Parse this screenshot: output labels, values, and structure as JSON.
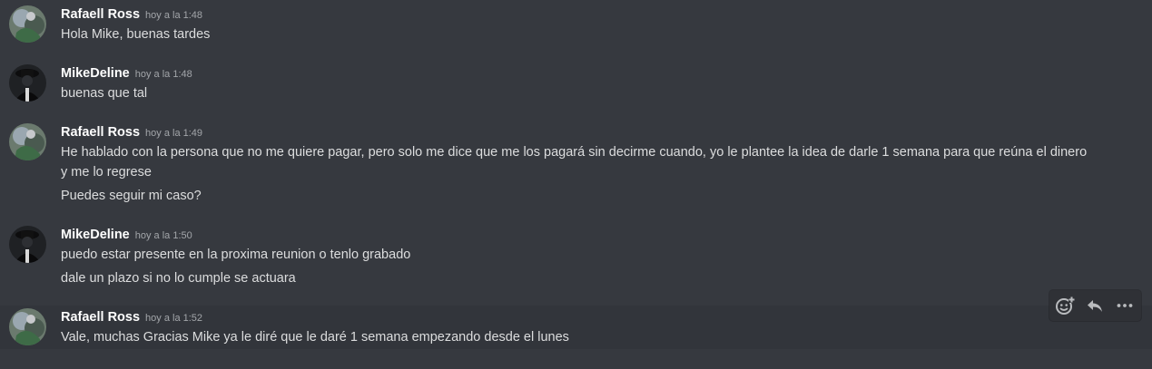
{
  "messages": [
    {
      "username": "Rafaell Ross",
      "timestamp": "hoy a la 1:48",
      "avatar": "rafaell-avatar",
      "lines": [
        "Hola Mike, buenas tardes"
      ]
    },
    {
      "username": "MikeDeline",
      "timestamp": "hoy a la 1:48",
      "avatar": "mike-avatar",
      "lines": [
        "buenas que tal"
      ]
    },
    {
      "username": "Rafaell Ross",
      "timestamp": "hoy a la 1:49",
      "avatar": "rafaell-avatar",
      "lines": [
        "He hablado con la persona que no me quiere pagar, pero solo me dice que me los pagará sin decirme cuando, yo le plantee la idea de darle 1 semana para que reúna el dinero",
        "y me lo regrese",
        "Puedes seguir mi caso?"
      ]
    },
    {
      "username": "MikeDeline",
      "timestamp": "hoy a la 1:50",
      "avatar": "mike-avatar",
      "lines": [
        "puedo estar presente en la proxima reunion o tenlo grabado",
        "dale un plazo si no lo cumple se actuara"
      ]
    },
    {
      "username": "Rafaell Ross",
      "timestamp": "hoy a la 1:52",
      "avatar": "rafaell-avatar",
      "lines": [
        "Vale, muchas Gracias Mike ya le diré que le daré 1 semana empezando desde el lunes"
      ]
    }
  ],
  "toolbar": {
    "icons": [
      "add-reaction-icon",
      "reply-icon",
      "more-options-icon"
    ]
  },
  "colors": {
    "background": "#36393f",
    "hover_background": "#32353b",
    "username": "#ffffff",
    "message_text": "#dcddde",
    "timestamp": "#a3a6aa",
    "toolbar_icon": "#b9bbbe"
  }
}
